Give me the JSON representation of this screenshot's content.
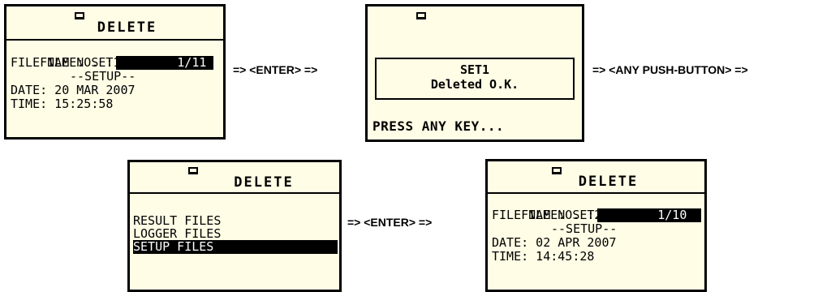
{
  "screen1": {
    "title": "DELETE",
    "file_no_label": "FILE NO. :",
    "file_no_value": "1/11",
    "file_name": "FILE NAME: SET1",
    "section": "--SETUP--",
    "date": "DATE: 20 MAR 2007",
    "time": "TIME: 15:25:58"
  },
  "screen2": {
    "message_name": "SET1",
    "message_status": "Deleted O.K.",
    "footer": "PRESS ANY KEY..."
  },
  "screen3": {
    "title": "DELETE",
    "items": [
      "RESULT FILES",
      "LOGGER FILES",
      "SETUP FILES"
    ],
    "selected_index": 2
  },
  "screen4": {
    "title": "DELETE",
    "file_no_label": "FILE NO. :",
    "file_no_value": "1/10",
    "file_name": "FILE NAME: SET2",
    "section": "--SETUP--",
    "date": "DATE: 02 APR 2007",
    "time": "TIME: 14:45:28"
  },
  "arrows": {
    "enter_1": "=> <ENTER> =>",
    "any_push": "=> <ANY PUSH-BUTTON> =>",
    "enter_2": "=> <ENTER> =>"
  },
  "icon_names": [
    "instrument-icon"
  ]
}
